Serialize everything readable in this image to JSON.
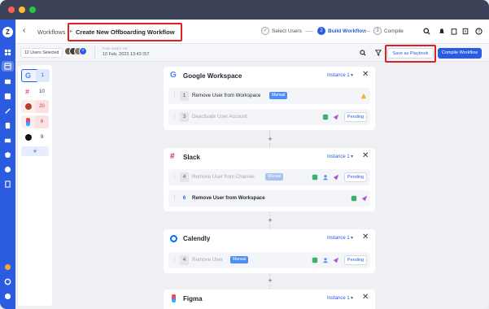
{
  "nav": {
    "back_label": "Workflows",
    "title": "Create New Offboarding Workflow",
    "steps": [
      {
        "label": "Select Users",
        "marker": "✓"
      },
      {
        "label": "Build Workflow",
        "marker": "2"
      },
      {
        "label": "Compile",
        "marker": "3"
      }
    ]
  },
  "subbar": {
    "users_selected": "12 Users Selected",
    "avatar_more": "+",
    "published_label": "PUBLISHED ON",
    "published_date": "10 Feb, 2023 13:43 IST",
    "save_playbook": "Save as Playbook",
    "compile_workflow": "Compile Workflow"
  },
  "apps": [
    {
      "icon": "google-icon",
      "count": "1"
    },
    {
      "icon": "slack-icon",
      "count": "10"
    },
    {
      "icon": "calendly-icon",
      "count": "20"
    },
    {
      "icon": "figma-icon",
      "count": "6"
    },
    {
      "icon": "github-icon",
      "count": "9"
    }
  ],
  "add_app": "+",
  "instance_label": "Instance 1",
  "cards": [
    {
      "name": "Google Workspace",
      "steps": [
        {
          "num": "1",
          "label": "Remove User from Workspace",
          "badge": "Manual",
          "status": ""
        },
        {
          "num": "3",
          "label": "Deactivate User Account",
          "badge": "",
          "status": "Pending"
        }
      ]
    },
    {
      "name": "Slack",
      "steps": [
        {
          "num": "4",
          "label": "Remove User from Channel",
          "badge": "Manual",
          "status": "Pending"
        },
        {
          "num": "6",
          "label": "Remove User from Workspace",
          "badge": "",
          "status": ""
        }
      ]
    },
    {
      "name": "Calendly",
      "steps": [
        {
          "num": "4",
          "label": "Remove User",
          "badge": "Manual",
          "status": "Pending"
        }
      ]
    },
    {
      "name": "Figma",
      "steps": []
    }
  ],
  "colors": {
    "brand": "#2a5be0",
    "titlebar": "#3c4258",
    "highlight": "#e02020"
  }
}
